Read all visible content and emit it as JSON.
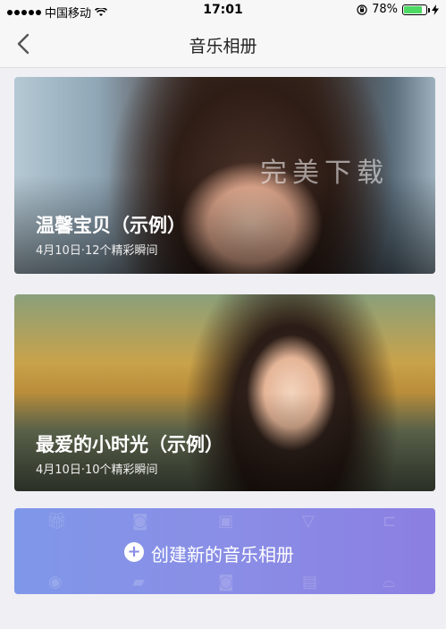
{
  "status_bar": {
    "carrier": "中国移动",
    "time": "17:01",
    "battery": "78%",
    "battery_level": 0.78,
    "colors": {
      "battery_fill": "#4cd964"
    }
  },
  "nav": {
    "title": "音乐相册",
    "back_icon": "chevron-left-icon"
  },
  "albums": [
    {
      "name": "温馨宝贝（示例）",
      "meta": "4月10日·12个精彩瞬间",
      "watermark": "完美下载"
    },
    {
      "name": "最爱的小时光（示例）",
      "meta": "4月10日·10个精彩瞬间"
    }
  ],
  "create": {
    "label": "创建新的音乐相册",
    "icon": "plus-circle-icon",
    "colors": {
      "start": "#7f97e8",
      "end": "#8b7fe2"
    }
  }
}
